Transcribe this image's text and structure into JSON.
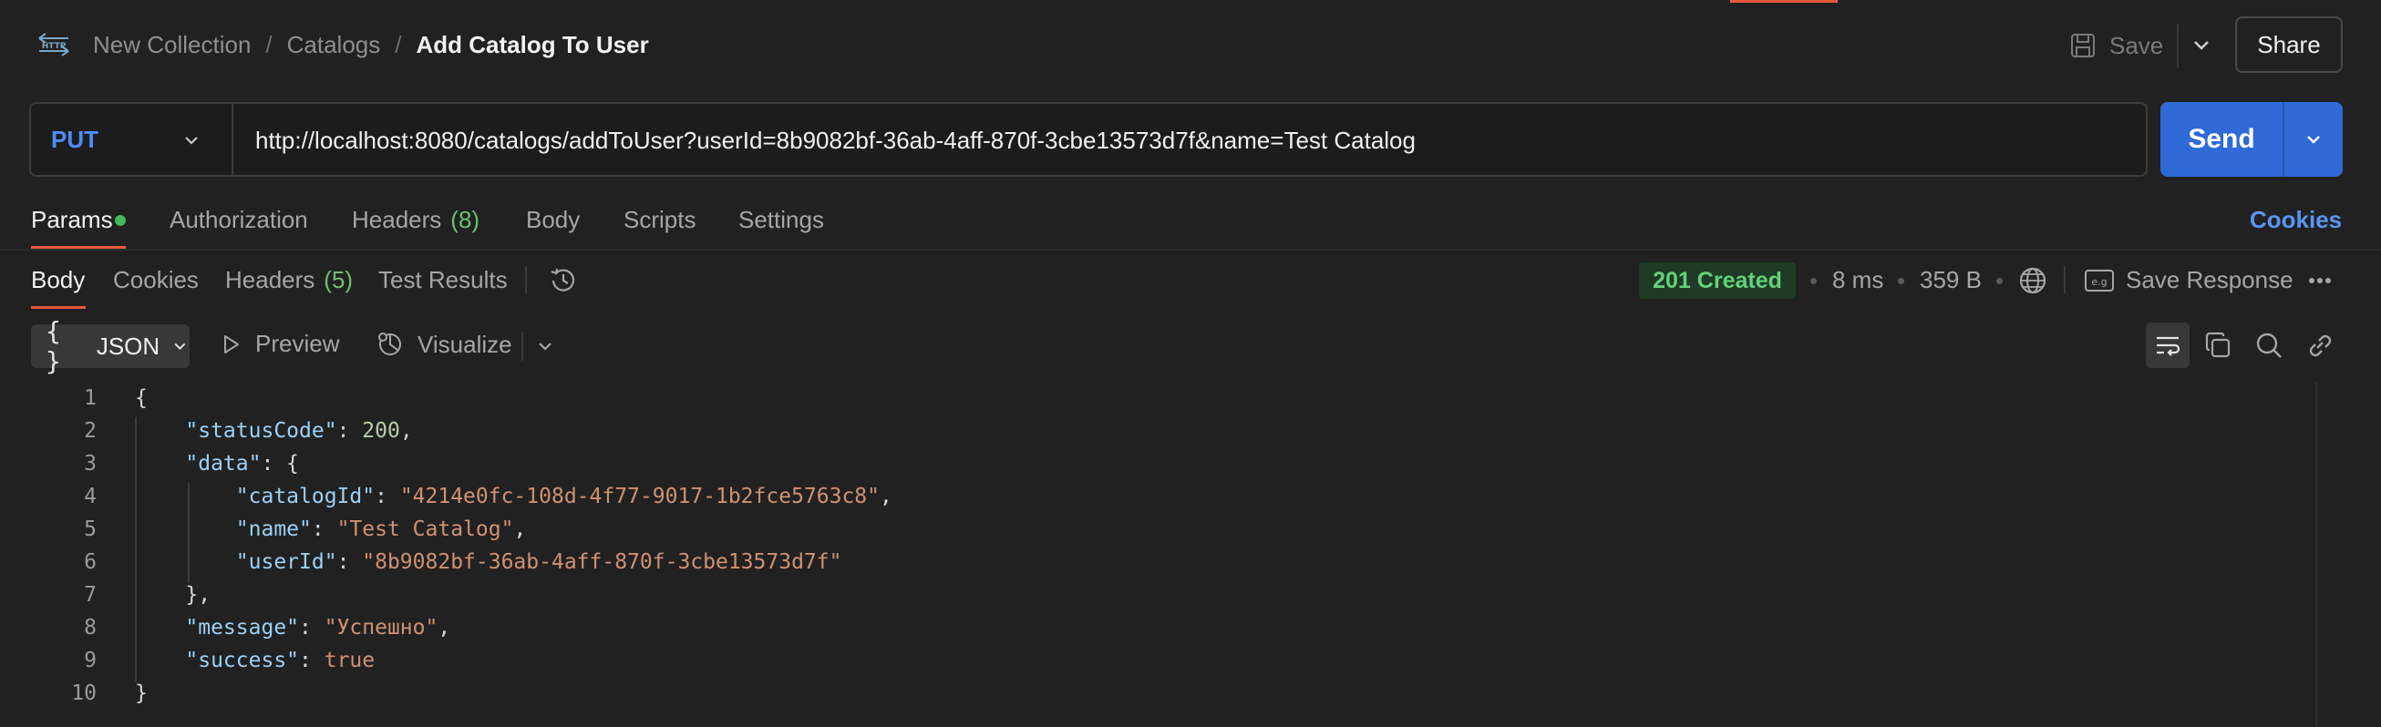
{
  "header": {
    "breadcrumb": [
      "New Collection",
      "Catalogs",
      "Add Catalog To User"
    ],
    "save_label": "Save",
    "share_label": "Share"
  },
  "request": {
    "method": "PUT",
    "url": "http://localhost:8080/catalogs/addToUser?userId=8b9082bf-36ab-4aff-870f-3cbe13573d7f&name=Test Catalog",
    "send_label": "Send",
    "tabs": {
      "params": "Params",
      "authorization": "Authorization",
      "headers": "Headers",
      "headers_count": "(8)",
      "body": "Body",
      "scripts": "Scripts",
      "settings": "Settings"
    },
    "cookies_label": "Cookies"
  },
  "response": {
    "tabs": {
      "body": "Body",
      "cookies": "Cookies",
      "headers": "Headers",
      "headers_count": "(5)",
      "test_results": "Test Results"
    },
    "status": "201 Created",
    "time": "8 ms",
    "size": "359 B",
    "save_response_label": "Save Response",
    "format": "JSON",
    "preview_label": "Preview",
    "visualize_label": "Visualize",
    "code": {
      "line_numbers": [
        "1",
        "2",
        "3",
        "4",
        "5",
        "6",
        "7",
        "8",
        "9",
        "10"
      ],
      "status_code_key": "\"statusCode\"",
      "status_code_value": "200",
      "data_key": "\"data\"",
      "catalog_id_key": "\"catalogId\"",
      "catalog_id_value": "\"4214e0fc-108d-4f77-9017-1b2fce5763c8\"",
      "name_key": "\"name\"",
      "name_value": "\"Test Catalog\"",
      "user_id_key": "\"userId\"",
      "user_id_value": "\"8b9082bf-36ab-4aff-870f-3cbe13573d7f\"",
      "message_key": "\"message\"",
      "message_value": "\"Успешно\"",
      "success_key": "\"success\"",
      "success_value": "true"
    }
  },
  "colors": {
    "accent": "#e8593a",
    "send": "#2f6ad6",
    "method": "#4e8cf7",
    "status_ok": "#64d17a"
  }
}
